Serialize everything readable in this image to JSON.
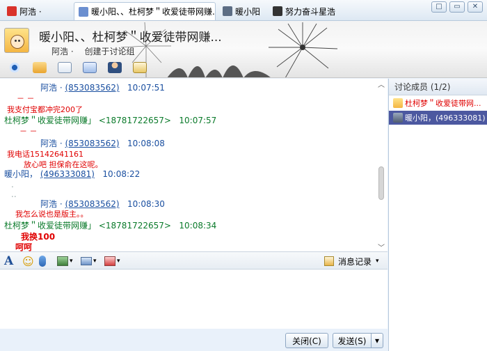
{
  "tabs": [
    {
      "label": "阿浩 ·"
    },
    {
      "label": "暖小阳、、杜柯梦＂收爱徒带网赚..."
    },
    {
      "label": "暖小阳"
    },
    {
      "label": "努力奋斗星浩"
    }
  ],
  "window_buttons": {
    "restore": "□",
    "maximize": "▭",
    "close": "✕"
  },
  "header": {
    "title": "暖小阳、、杜柯梦＂收爱徒带网赚...",
    "owner": "阿浩 ·",
    "created_by": "创建于讨论组"
  },
  "toolbar_icons": [
    "eye-icon",
    "transfer-icon",
    "mail-icon",
    "add-member-icon",
    "person-icon",
    "notes-icon"
  ],
  "messages": [
    {
      "sender": "阿浩 ·",
      "id": "(853083562)",
      "time": "10:07:51"
    },
    {
      "text": "－ －"
    },
    {
      "text": "我支付宝都冲完200了"
    },
    {
      "sender": "杜柯梦＂收爱徒带网赚」",
      "id": "<18781722657>",
      "time": "10:07:57"
    },
    {
      "text": "－ －"
    },
    {
      "sender": "阿浩 ·",
      "id": "(853083562)",
      "time": "10:08:08"
    },
    {
      "text": "我电话15142641161"
    },
    {
      "text": "放心吧  担保俞在这呢。"
    },
    {
      "sender": "暖小阳，",
      "id": "(496333081)",
      "time": "10:08:22"
    },
    {
      "text": "."
    },
    {
      "text": ".."
    },
    {
      "sender": "阿浩 ·",
      "id": "(853083562)",
      "time": "10:08:30"
    },
    {
      "text": "我怎么说也是版主。。"
    },
    {
      "sender": "杜柯梦＂收爱徒带网赚」",
      "id": "<18781722657>",
      "time": "10:08:34"
    },
    {
      "text": "我换100"
    },
    {
      "text": "呵呵"
    }
  ],
  "compose_toolbar": {
    "font": "A",
    "emoji": "☺",
    "history": "消息记录"
  },
  "buttons": {
    "close": "关闭(C)",
    "send": "发送(S)",
    "send_dropdown": "▾"
  },
  "panel": {
    "title": "讨论成员 (1/2)",
    "members": [
      {
        "name": "杜柯梦＂收爱徒带网..."
      },
      {
        "name": "暖小阳，(496333081)"
      }
    ]
  },
  "colors": {
    "accent": "#4c58a0",
    "sender_blue": "#1a4fa0",
    "sender_green": "#0a7a2a",
    "msg_red": "#e00000"
  }
}
